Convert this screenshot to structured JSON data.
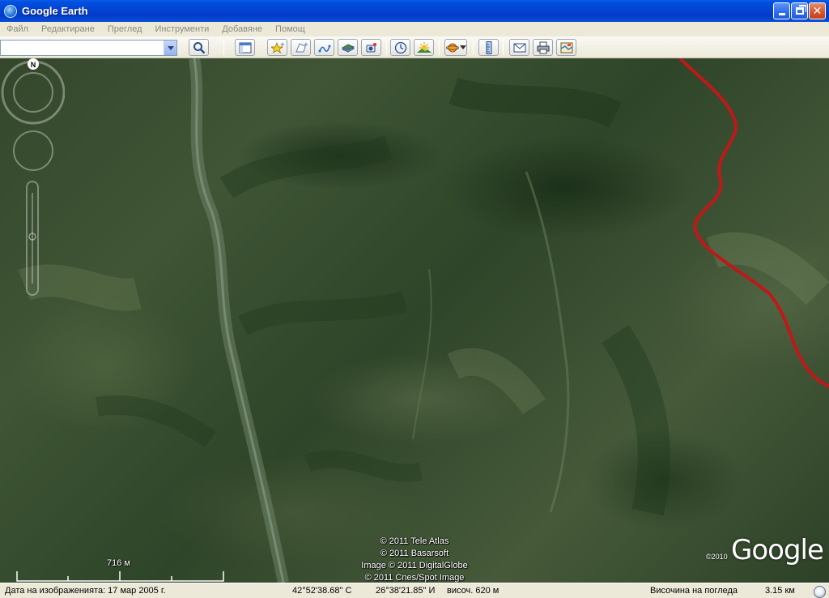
{
  "window": {
    "title": "Google Earth",
    "icon": "google-earth-globe-icon"
  },
  "menu": {
    "items": [
      "Файл",
      "Редактиране",
      "Преглед",
      "Инструменти",
      "Добавяне",
      "Помощ"
    ]
  },
  "toolbar": {
    "search_value": "",
    "buttons": [
      "search-icon",
      "sidebar-toggle-icon",
      "placemark-icon",
      "polygon-icon",
      "path-icon",
      "image-overlay-icon",
      "record-tour-icon",
      "historical-imagery-icon",
      "sunlight-icon",
      "planets-icon",
      "ruler-icon",
      "email-icon",
      "print-icon",
      "view-in-maps-icon"
    ]
  },
  "map": {
    "copyrights": [
      "© 2011 Tele Atlas",
      "© 2011 Basarsoft",
      "Image © 2011 DigitalGlobe",
      "© 2011 Cnes/Spot Image"
    ],
    "logo_year": "©2010",
    "logo_text": "Google",
    "north_label": "N",
    "scale_label": "716 м",
    "colors": {
      "road": "#c01818",
      "terrain_dark": "#2f4529",
      "terrain_light": "#5f6f4e"
    }
  },
  "status": {
    "image_date": "Дата на изображенията: 17 мар 2005 г.",
    "latitude": "42°52'38.68\" С",
    "longitude": "26°38'21.85\" И",
    "elevation": "височ.  620 м",
    "eye_alt_label": "Височина на погледа",
    "eye_alt_value": "3.15 км"
  }
}
